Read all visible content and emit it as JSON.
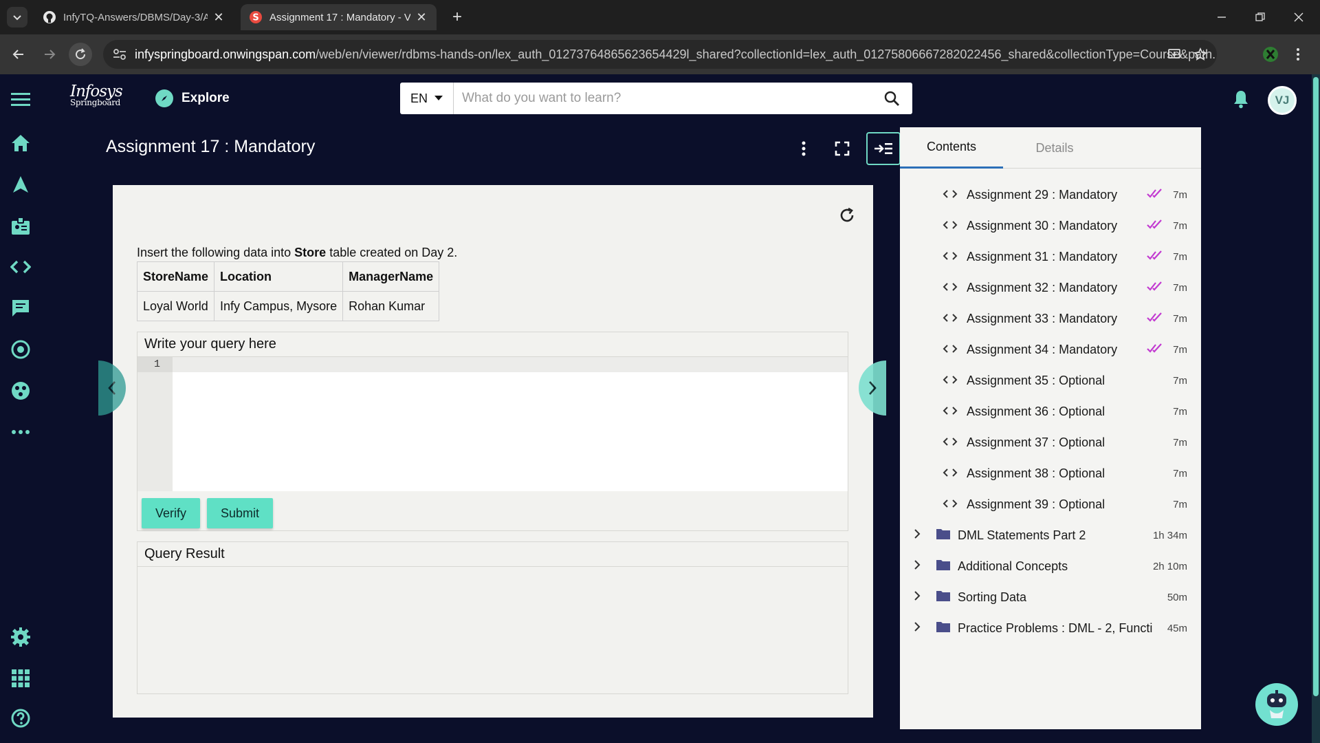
{
  "browser": {
    "tabs": [
      {
        "title": "InfyTQ-Answers/DBMS/Day-3/A",
        "active": false
      },
      {
        "title": "Assignment 17 : Mandatory - V",
        "active": true
      }
    ],
    "url_host": "infyspringboard.onwingspan.com",
    "url_path": "/web/en/viewer/rdbms-hands-on/lex_auth_01273764865623654429l_shared?collectionId=lex_auth_01275806667282022456_shared&collectionType=Course&path..."
  },
  "header": {
    "logo_line1": "Infosys",
    "logo_line2": "Springboard",
    "explore_label": "Explore",
    "language": "EN",
    "search_placeholder": "What do you want to learn?",
    "avatar_initials": "VJ"
  },
  "viewer": {
    "title": "Assignment 17 : Mandatory",
    "instruction_prefix": "Insert the following data into",
    "instruction_table": "Store",
    "instruction_suffix": "table created on Day 2.",
    "table": {
      "headers": [
        "StoreName",
        "Location",
        "ManagerName"
      ],
      "rows": [
        [
          "Loyal World",
          "Infy Campus, Mysore",
          "Rohan Kumar"
        ]
      ]
    },
    "editor_title": "Write your query here",
    "line_number": "1",
    "verify_label": "Verify",
    "submit_label": "Submit",
    "result_title": "Query Result"
  },
  "contents": {
    "tab_contents": "Contents",
    "tab_details": "Details",
    "items": [
      {
        "label": "Assignment 29 : Mandatory",
        "duration": "7m",
        "completed": true
      },
      {
        "label": "Assignment 30 : Mandatory",
        "duration": "7m",
        "completed": true
      },
      {
        "label": "Assignment 31 : Mandatory",
        "duration": "7m",
        "completed": true
      },
      {
        "label": "Assignment 32 : Mandatory",
        "duration": "7m",
        "completed": true
      },
      {
        "label": "Assignment 33 : Mandatory",
        "duration": "7m",
        "completed": true
      },
      {
        "label": "Assignment 34 : Mandatory",
        "duration": "7m",
        "completed": true
      },
      {
        "label": "Assignment 35 : Optional",
        "duration": "7m",
        "completed": false
      },
      {
        "label": "Assignment 36 : Optional",
        "duration": "7m",
        "completed": false
      },
      {
        "label": "Assignment 37 : Optional",
        "duration": "7m",
        "completed": false
      },
      {
        "label": "Assignment 38 : Optional",
        "duration": "7m",
        "completed": false
      },
      {
        "label": "Assignment 39 : Optional",
        "duration": "7m",
        "completed": false
      }
    ],
    "folders": [
      {
        "label": "DML Statements Part 2",
        "duration": "1h 34m"
      },
      {
        "label": "Additional Concepts",
        "duration": "2h 10m"
      },
      {
        "label": "Sorting Data",
        "duration": "50m"
      },
      {
        "label": "Practice Problems : DML - 2, Functi",
        "duration": "45m"
      }
    ]
  },
  "colors": {
    "accent": "#6fd9c4",
    "background": "#0b0f2a",
    "check": "#c23ad1",
    "button": "#5fe0c5"
  }
}
